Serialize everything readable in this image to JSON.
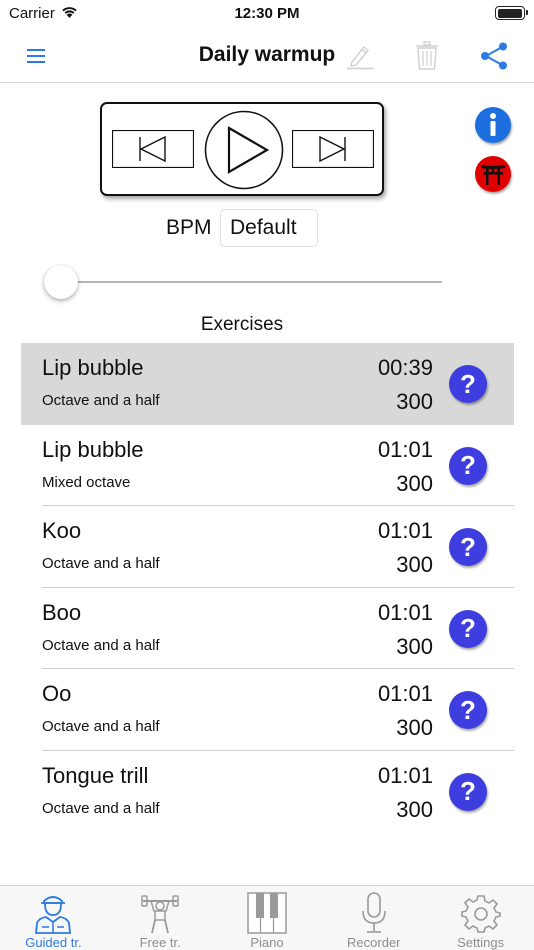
{
  "status_bar": {
    "carrier": "Carrier",
    "time": "12:30 PM",
    "battery_level": 1.0
  },
  "nav_bar": {
    "title": "Daily warmup",
    "menu_icon": "hamburger-menu-icon",
    "edit_icon": "pencil-icon",
    "delete_icon": "trash-icon",
    "share_icon": "share-icon"
  },
  "transport": {
    "previous_icon": "skip-previous-icon",
    "play_icon": "play-icon",
    "next_icon": "skip-next-icon"
  },
  "side_buttons": {
    "info_icon": "info-icon",
    "torii_icon": "torii-gate-icon"
  },
  "bpm": {
    "label": "BPM",
    "value": "Default",
    "slider_value": 0.0
  },
  "exercises": {
    "title": "Exercises",
    "items": [
      {
        "name": "Lip bubble",
        "range": "Octave and a half",
        "duration": "00:39",
        "count": "300",
        "help": "?",
        "selected": true
      },
      {
        "name": "Lip bubble",
        "range": "Mixed octave",
        "duration": "01:01",
        "count": "300",
        "help": "?",
        "selected": false
      },
      {
        "name": "Koo",
        "range": "Octave and a half",
        "duration": "01:01",
        "count": "300",
        "help": "?",
        "selected": false
      },
      {
        "name": "Boo",
        "range": "Octave and a half",
        "duration": "01:01",
        "count": "300",
        "help": "?",
        "selected": false
      },
      {
        "name": "Oo",
        "range": "Octave and a half",
        "duration": "01:01",
        "count": "300",
        "help": "?",
        "selected": false
      },
      {
        "name": "Tongue trill",
        "range": "Octave and a half",
        "duration": "01:01",
        "count": "300",
        "help": "?",
        "selected": false
      }
    ]
  },
  "tab_bar": {
    "tabs": [
      {
        "label": "Guided tr.",
        "icon": "trainer-person-icon",
        "active": true
      },
      {
        "label": "Free tr.",
        "icon": "weightlifter-icon",
        "active": false
      },
      {
        "label": "Piano",
        "icon": "piano-keys-icon",
        "active": false
      },
      {
        "label": "Recorder",
        "icon": "microphone-icon",
        "active": false
      },
      {
        "label": "Settings",
        "icon": "gear-icon",
        "active": false
      }
    ]
  },
  "colors": {
    "accent": "#2c7be5",
    "help_button": "#3d3de0",
    "selected_row": "#d8d8d8",
    "torii_red": "#e00000",
    "info_blue": "#1d6fe0"
  }
}
